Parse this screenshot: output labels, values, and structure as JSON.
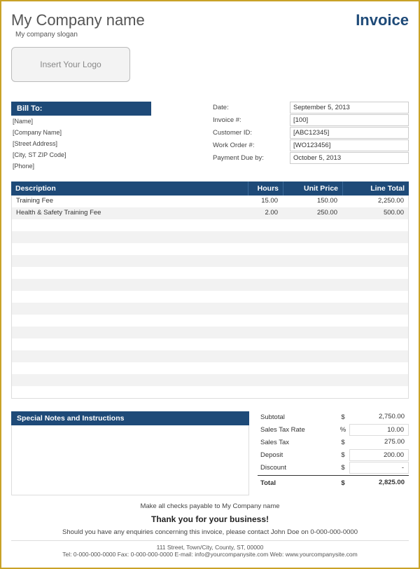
{
  "header": {
    "company_name": "My Company name",
    "slogan": "My company slogan",
    "invoice_title": "Invoice",
    "logo_placeholder": "Insert Your Logo"
  },
  "bill_to": {
    "header": "Bill To:",
    "lines": [
      "[Name]",
      "[Company Name]",
      "[Street Address]",
      "[City, ST  ZIP Code]",
      "[Phone]"
    ]
  },
  "meta": [
    {
      "label": "Date:",
      "value": "September 5, 2013"
    },
    {
      "label": "Invoice #:",
      "value": "[100]"
    },
    {
      "label": "Customer ID:",
      "value": "[ABC12345]"
    },
    {
      "label": "Work Order #:",
      "value": "[WO123456]"
    },
    {
      "label": "Payment Due by:",
      "value": "October 5, 2013"
    }
  ],
  "columns": {
    "desc": "Description",
    "hours": "Hours",
    "unit": "Unit Price",
    "total": "Line Total"
  },
  "items": [
    {
      "desc": "Training Fee",
      "hours": "15.00",
      "unit": "150.00",
      "total": "2,250.00"
    },
    {
      "desc": "Health & Safety Training Fee",
      "hours": "2.00",
      "unit": "250.00",
      "total": "500.00"
    },
    {
      "desc": "",
      "hours": "",
      "unit": "",
      "total": ""
    },
    {
      "desc": "",
      "hours": "",
      "unit": "",
      "total": ""
    },
    {
      "desc": "",
      "hours": "",
      "unit": "",
      "total": ""
    },
    {
      "desc": "",
      "hours": "",
      "unit": "",
      "total": ""
    },
    {
      "desc": "",
      "hours": "",
      "unit": "",
      "total": ""
    },
    {
      "desc": "",
      "hours": "",
      "unit": "",
      "total": ""
    },
    {
      "desc": "",
      "hours": "",
      "unit": "",
      "total": ""
    },
    {
      "desc": "",
      "hours": "",
      "unit": "",
      "total": ""
    },
    {
      "desc": "",
      "hours": "",
      "unit": "",
      "total": ""
    },
    {
      "desc": "",
      "hours": "",
      "unit": "",
      "total": ""
    },
    {
      "desc": "",
      "hours": "",
      "unit": "",
      "total": ""
    },
    {
      "desc": "",
      "hours": "",
      "unit": "",
      "total": ""
    },
    {
      "desc": "",
      "hours": "",
      "unit": "",
      "total": ""
    },
    {
      "desc": "",
      "hours": "",
      "unit": "",
      "total": ""
    },
    {
      "desc": "",
      "hours": "",
      "unit": "",
      "total": ""
    }
  ],
  "notes_header": "Special Notes and Instructions",
  "totals": {
    "subtotal": {
      "label": "Subtotal",
      "sym": "$",
      "value": "2,750.00"
    },
    "taxrate": {
      "label": "Sales Tax Rate",
      "sym": "%",
      "value": "10.00"
    },
    "tax": {
      "label": "Sales Tax",
      "sym": "$",
      "value": "275.00"
    },
    "deposit": {
      "label": "Deposit",
      "sym": "$",
      "value": "200.00"
    },
    "discount": {
      "label": "Discount",
      "sym": "$",
      "value": "-"
    },
    "grand": {
      "label": "Total",
      "sym": "$",
      "value": "2,825.00"
    }
  },
  "footer": {
    "payable": "Make all checks payable to My Company name",
    "thanks": "Thank you for your business!",
    "enquiries": "Should you have any enquiries concerning this invoice, please contact John Doe on 0-000-000-0000",
    "address": "111 Street, Town/City, County, ST, 00000",
    "contact": "Tel: 0-000-000-0000 Fax: 0-000-000-0000 E-mail: info@yourcompanysite.com Web: www.yourcompanysite.com"
  }
}
